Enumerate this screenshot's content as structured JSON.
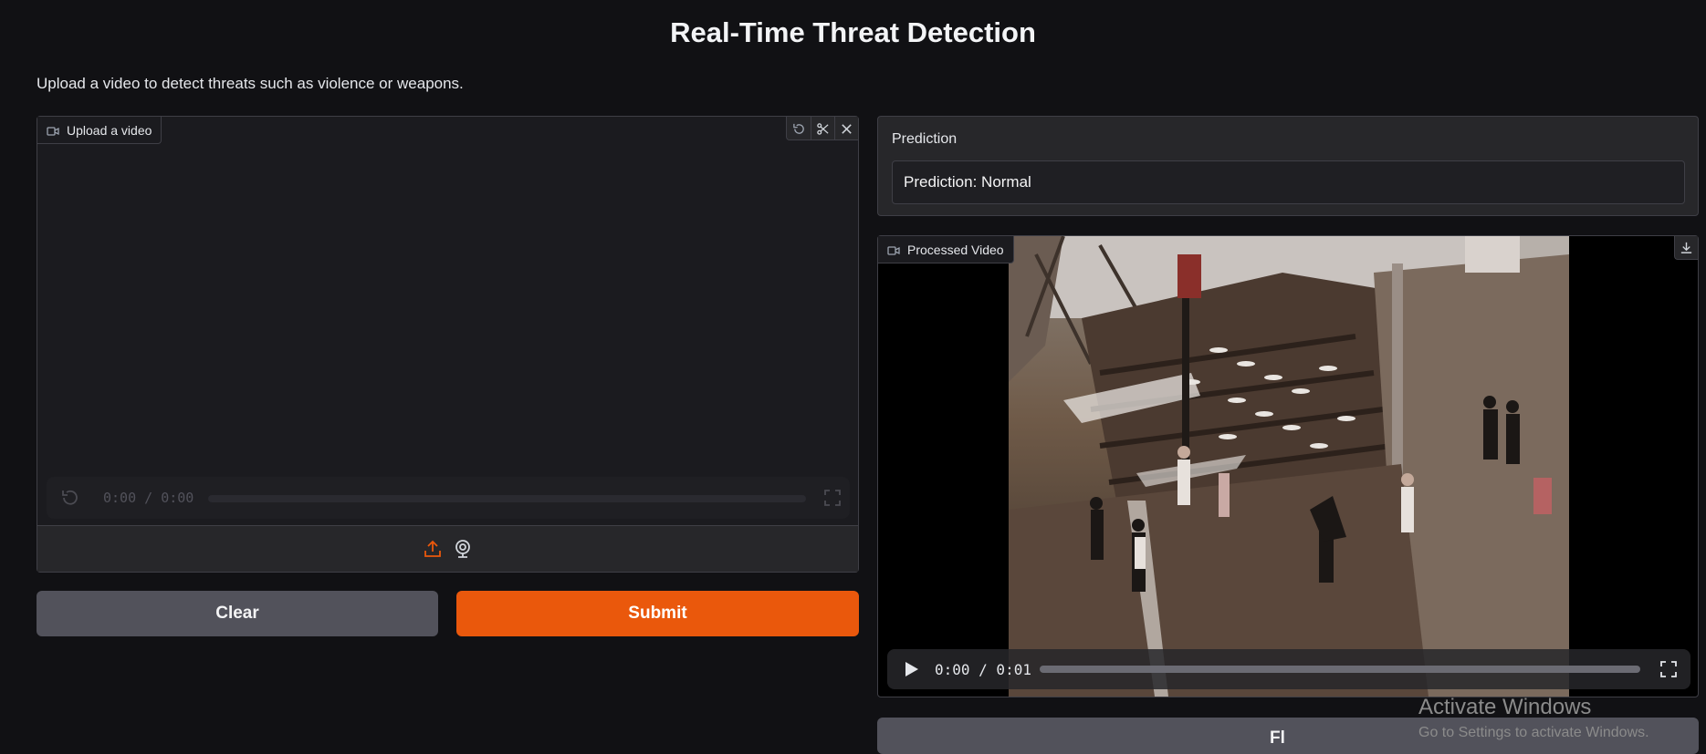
{
  "page": {
    "title": "Real-Time Threat Detection",
    "subtitle": "Upload a video to detect threats such as violence or weapons."
  },
  "upload": {
    "label": "Upload a video",
    "time": "0:00 / 0:00",
    "icons": [
      "undo-icon",
      "scissors-icon",
      "close-icon",
      "replay-icon",
      "fullscreen-icon",
      "upload-icon",
      "webcam-icon"
    ]
  },
  "buttons": {
    "clear": "Clear",
    "submit": "Submit",
    "flag_partial": "Fl"
  },
  "prediction": {
    "label": "Prediction",
    "value": "Prediction: Normal"
  },
  "processed": {
    "label": "Processed Video",
    "time": "0:00 / 0:01",
    "icons": [
      "download-icon",
      "play-icon",
      "fullscreen-icon"
    ]
  },
  "watermark": {
    "line1": "Activate Windows",
    "line2": "Go to Settings to activate Windows."
  },
  "colors": {
    "accent": "#ea580c",
    "background": "#111114",
    "panel": "#1b1b1f",
    "secondary_button": "#52525b"
  }
}
